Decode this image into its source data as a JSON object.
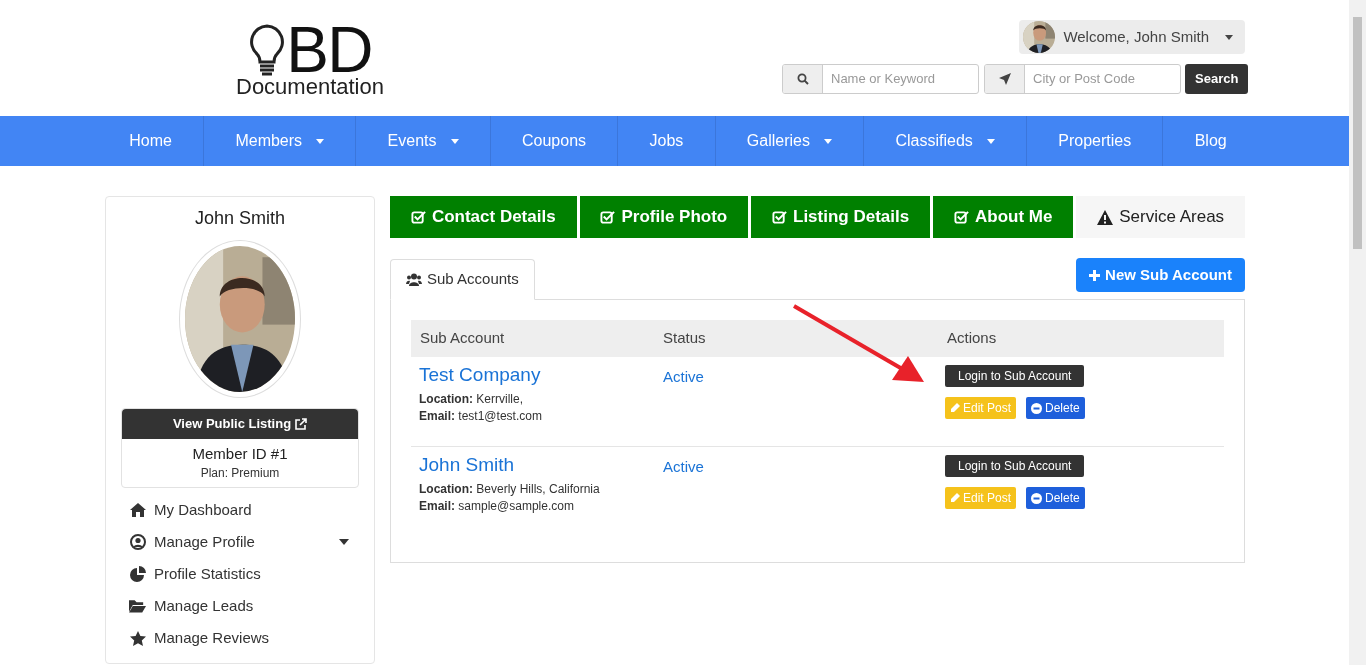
{
  "logo": {
    "title": "BD",
    "subtitle": "Documentation"
  },
  "user_menu": {
    "label": "Welcome, John Smith"
  },
  "search": {
    "keyword_placeholder": "Name or Keyword",
    "location_placeholder": "City or Post Code",
    "button": "Search"
  },
  "nav": [
    {
      "label": "Home",
      "dropdown": false
    },
    {
      "label": "Members",
      "dropdown": true
    },
    {
      "label": "Events",
      "dropdown": true
    },
    {
      "label": "Coupons",
      "dropdown": false
    },
    {
      "label": "Jobs",
      "dropdown": false
    },
    {
      "label": "Galleries",
      "dropdown": true
    },
    {
      "label": "Classifieds",
      "dropdown": true
    },
    {
      "label": "Properties",
      "dropdown": false
    },
    {
      "label": "Blog",
      "dropdown": false
    }
  ],
  "profile": {
    "name": "John Smith",
    "view_button": "View Public Listing",
    "member_id": "Member ID #1",
    "plan": "Plan: Premium"
  },
  "sidebar": {
    "items": [
      {
        "label": "My Dashboard",
        "kind": "home",
        "expandable": false
      },
      {
        "label": "Manage Profile",
        "kind": "user",
        "expandable": true
      },
      {
        "label": "Profile Statistics",
        "kind": "chart",
        "expandable": false
      },
      {
        "label": "Manage Leads",
        "kind": "folder",
        "expandable": false
      },
      {
        "label": "Manage Reviews",
        "kind": "star",
        "expandable": false
      }
    ]
  },
  "steps": [
    {
      "label": "Contact Details",
      "complete": true
    },
    {
      "label": "Profile Photo",
      "complete": true
    },
    {
      "label": "Listing Details",
      "complete": true
    },
    {
      "label": "About Me",
      "complete": true
    },
    {
      "label": "Service Areas",
      "complete": false
    }
  ],
  "tabs": [
    {
      "label": "Sub Accounts",
      "selected": true
    }
  ],
  "new_button": "New Sub Account",
  "table": {
    "columns": [
      "Sub Account",
      "Status",
      "Actions"
    ],
    "rows": [
      {
        "name": "Test Company",
        "location_label": "Location:",
        "location": "Kerrville,",
        "email_label": "Email:",
        "email": "test1@test.com",
        "status": "Active",
        "login": "Login to Sub Account",
        "edit": "Edit Post",
        "delete": "Delete"
      },
      {
        "name": "John Smith",
        "location_label": "Location:",
        "location": "Beverly Hills, California",
        "email_label": "Email:",
        "email": "sample@sample.com",
        "status": "Active",
        "login": "Login to Sub Account",
        "edit": "Edit Post",
        "delete": "Delete"
      }
    ]
  }
}
